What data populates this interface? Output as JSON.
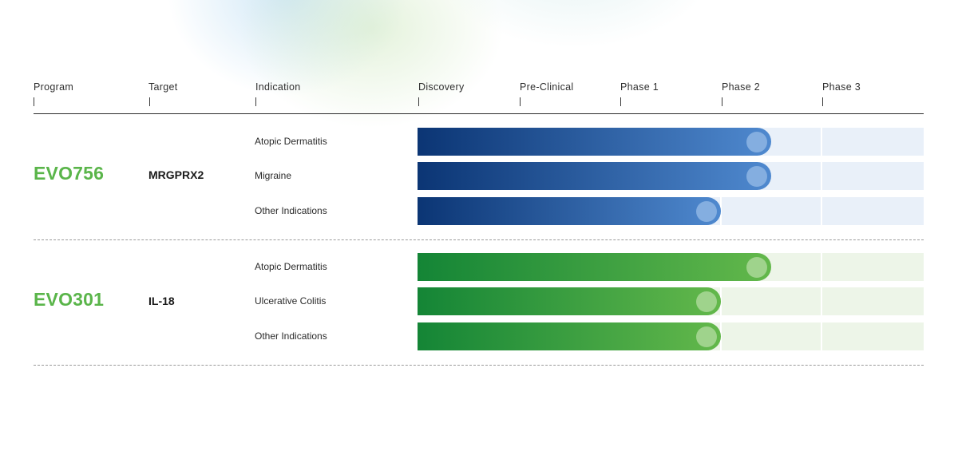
{
  "headers": {
    "program": "Program",
    "target": "Target",
    "indication": "Indication",
    "phases": [
      "Discovery",
      "Pre-Clinical",
      "Phase 1",
      "Phase 2",
      "Phase 3"
    ]
  },
  "colors": {
    "program_green": "#5ab54a",
    "blue_start": "#0b3574",
    "blue_end": "#4f89cf",
    "blue_knob": "#84aee0",
    "blue_track": "#e9f0f9",
    "green_start": "#148536",
    "green_end": "#63b84b",
    "green_knob": "#9fd38c",
    "green_track": "#edf5e8"
  },
  "chart_data": {
    "type": "bar",
    "orientation": "horizontal",
    "stages": [
      "Discovery",
      "Pre-Clinical",
      "Phase 1",
      "Phase 2",
      "Phase 3"
    ],
    "value_unit": "stage index (0 = start of Discovery, 5 = end of Phase 3)",
    "groups": [
      {
        "program": "EVO756",
        "target": "MRGPRX2",
        "color": "blue",
        "rows": [
          {
            "indication": "Atopic Dermatitis",
            "progress": 3.5
          },
          {
            "indication": "Migraine",
            "progress": 3.5
          },
          {
            "indication": "Other Indications",
            "progress": 3.0
          }
        ]
      },
      {
        "program": "EVO301",
        "target": "IL-18",
        "color": "green",
        "rows": [
          {
            "indication": "Atopic Dermatitis",
            "progress": 3.5
          },
          {
            "indication": "Ulcerative Colitis",
            "progress": 3.0
          },
          {
            "indication": "Other Indications",
            "progress": 3.0
          }
        ]
      }
    ]
  }
}
